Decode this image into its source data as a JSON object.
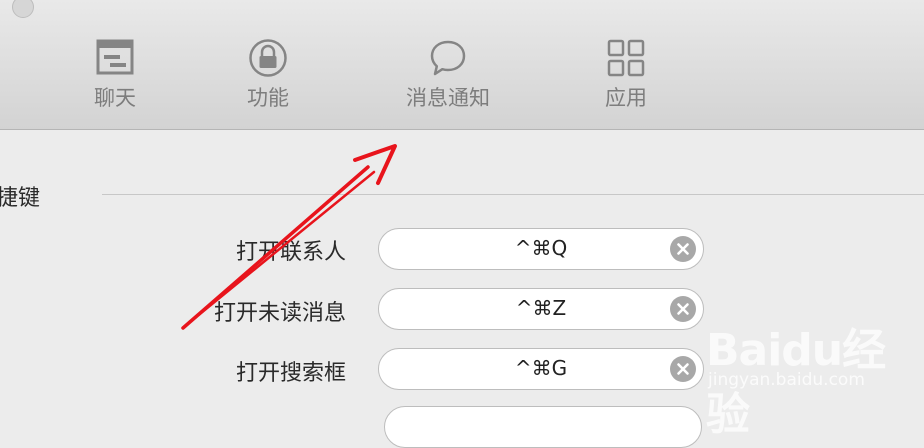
{
  "toolbar": {
    "tabs": [
      {
        "label": "聊天",
        "icon": "chat-window-icon"
      },
      {
        "label": "功能",
        "icon": "lock-icon"
      },
      {
        "label": "消息通知",
        "icon": "speech-bubble-icon"
      },
      {
        "label": "应用",
        "icon": "grid-icon"
      }
    ]
  },
  "section": {
    "title": "捷键"
  },
  "shortcuts": [
    {
      "label": "打开联系人",
      "value": "^⌘Q"
    },
    {
      "label": "打开未读消息",
      "value": "^⌘Z"
    },
    {
      "label": "打开搜索框",
      "value": "^⌘G"
    }
  ],
  "watermark": {
    "brand": "Baidu经验",
    "site": "jingyan.baidu.com"
  },
  "annotation": {
    "color": "#e8141c"
  }
}
